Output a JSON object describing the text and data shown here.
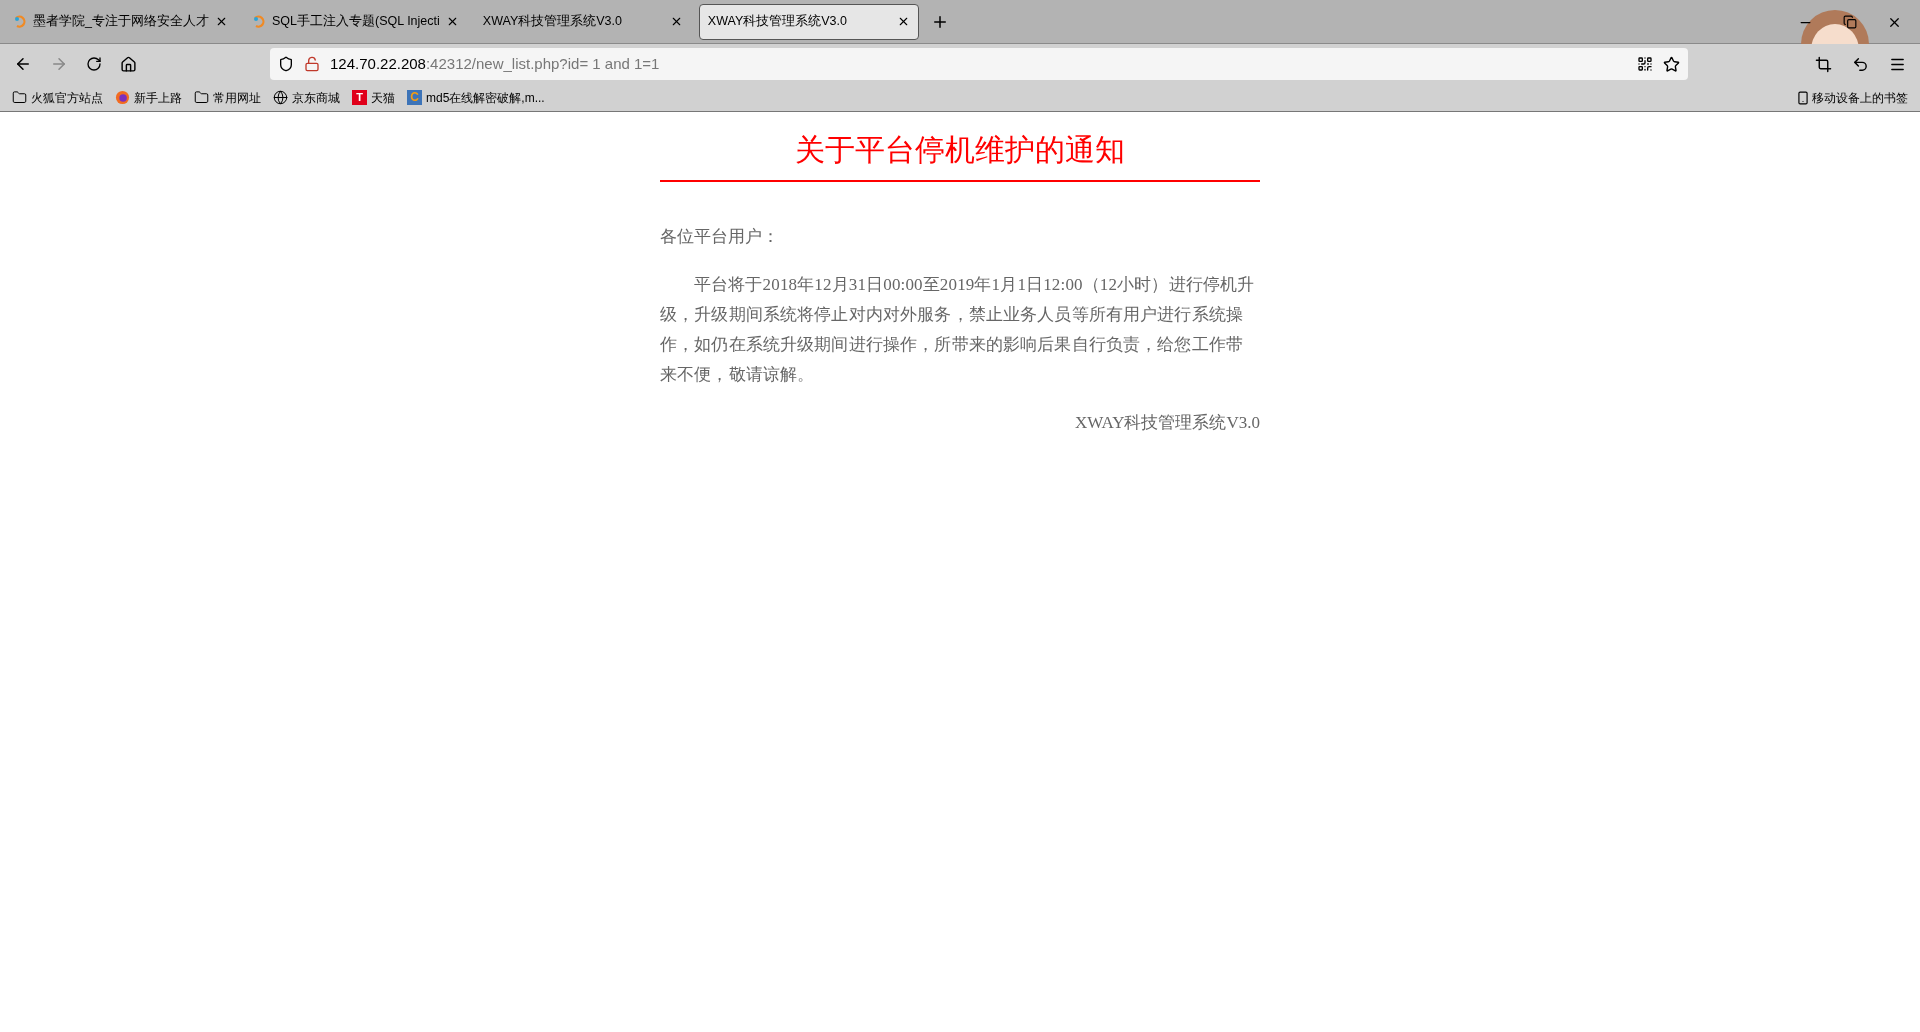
{
  "browser": {
    "tabs": [
      {
        "title": "墨者学院_专注于网络安全人才",
        "selected": false,
        "favicon": true
      },
      {
        "title": "SQL手工注入专题(SQL Injecti",
        "selected": false,
        "favicon": true
      },
      {
        "title": "XWAY科技管理系统V3.0",
        "selected": false,
        "favicon": false
      },
      {
        "title": "XWAY科技管理系统V3.0",
        "selected": true,
        "favicon": false
      }
    ],
    "url": {
      "host": "124.70.22.208",
      "rest": ":42312/new_list.php?id= 1 and 1=1"
    },
    "bookmarks": [
      {
        "kind": "folder",
        "label": "火狐官方站点"
      },
      {
        "kind": "firefox",
        "label": "新手上路"
      },
      {
        "kind": "folder",
        "label": "常用网址"
      },
      {
        "kind": "globe",
        "label": "京东商城"
      },
      {
        "kind": "tmall",
        "label": "天猫",
        "glyph": "T"
      },
      {
        "kind": "md5",
        "label": "md5在线解密破解,m...",
        "glyph": "C"
      }
    ],
    "mobile_bookmarks": "移动设备上的书签"
  },
  "notice": {
    "title": "关于平台停机维护的通知",
    "greeting": "各位平台用户：",
    "body": "平台将于2018年12月31日00:00至2019年1月1日12:00（12小时）进行停机升级，升级期间系统将停止对内对外服务，禁止业务人员等所有用户进行系统操作，如仍在系统升级期间进行操作，所带来的影响后果自行负责，给您工作带来不便，敬请谅解。",
    "signature": "XWAY科技管理系统V3.0"
  }
}
